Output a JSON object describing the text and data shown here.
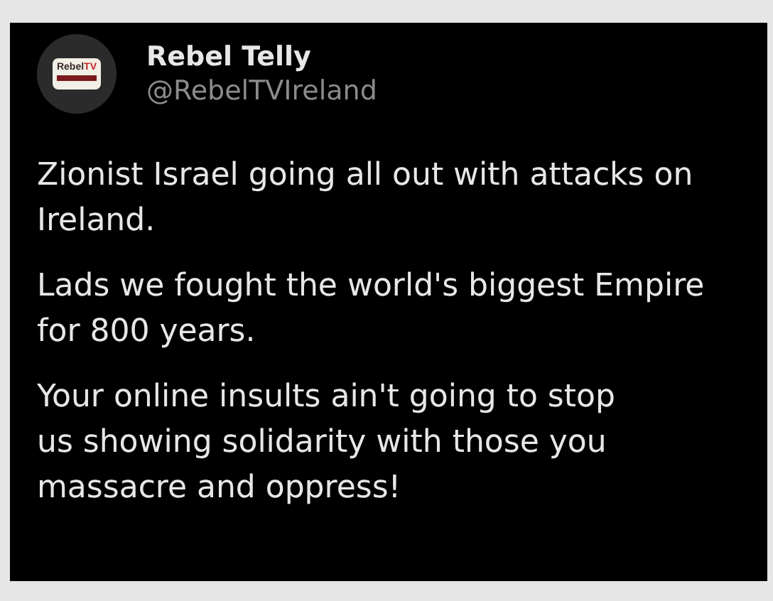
{
  "post": {
    "author": {
      "name": "Rebel Telly",
      "handle": "@RebelTVIreland",
      "avatar_logo": {
        "word": "Rebel",
        "accent": "TV"
      }
    },
    "paragraphs": [
      {
        "lines": [
          "Zionist Israel going all out with attacks on",
          "Ireland."
        ]
      },
      {
        "lines": [
          "Lads we fought the world's biggest Empire",
          "for 800 years."
        ]
      },
      {
        "lines": [
          "Your online insults ain't going to stop",
          "us showing solidarity with those you",
          "massacre and oppress!"
        ]
      }
    ]
  }
}
